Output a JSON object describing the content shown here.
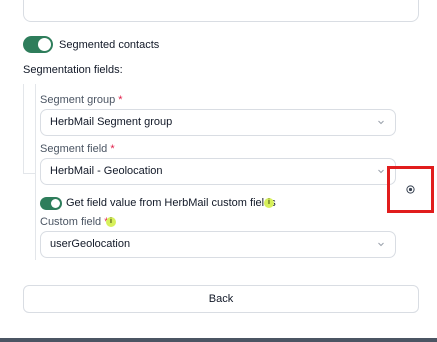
{
  "segmented_contacts": {
    "label": "Segmented contacts",
    "enabled": true
  },
  "segmentation_fields": {
    "label": "Segmentation fields:"
  },
  "segment_group": {
    "label": "Segment group",
    "required_marker": "*",
    "value": "HerbMail Segment group"
  },
  "segment_field": {
    "label": "Segment field",
    "required_marker": "*",
    "value": "HerbMail - Geolocation"
  },
  "custom_fields_toggle": {
    "label": "Get field value from HerbMail custom fields",
    "enabled": true,
    "info_glyph": "i"
  },
  "custom_field": {
    "label": "Custom field",
    "required_marker": "*",
    "info_glyph": "i",
    "value": "userGeolocation"
  },
  "back_button": {
    "label": "Back"
  },
  "colors": {
    "accent": "#2e7d5b",
    "required": "#e11d48",
    "highlight": "#e11d1d",
    "info": "#d7f05b"
  },
  "icons": {
    "select_arrow": "chevron-down-icon",
    "info": "info-icon",
    "cursor": "crosshair-icon"
  }
}
